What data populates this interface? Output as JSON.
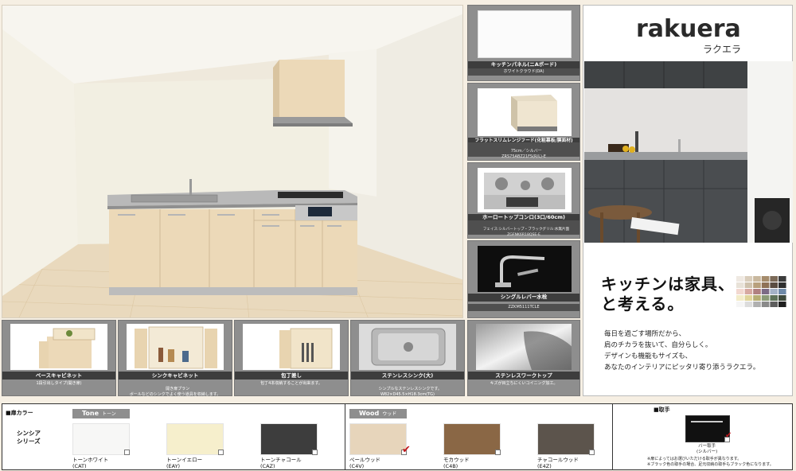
{
  "options": [
    {
      "caption": "キッチンパネル(ニAボード)",
      "note": "ホワイトクラウド(DA)"
    },
    {
      "caption": "フラットスリムレンジフード(化粧幕板/膜面材)",
      "note": "75cm／シルバー\nZRS75ABZ21FS(R/L)-E"
    },
    {
      "caption": "ホーロートップコンロ(3口/60cm)",
      "note": "フェイス:シルバートップ・ブラックグリル:水無片面\nZGFNK6R18QSE-E"
    },
    {
      "caption": "シングルレバー水栓",
      "note": "ZZKM5111TCLE"
    },
    {
      "caption": "ステンレスワークトップ",
      "note": "キズが目立ちにくいコイニング加工。"
    }
  ],
  "features": [
    {
      "title": "ベースキャビネット",
      "desc": "1段引出しタイプ(開き扉)"
    },
    {
      "title": "シンクキャビネット",
      "desc": "開き扉プラン\nボールなどのシンクでよく使う道具を収納します。"
    },
    {
      "title": "包丁差し",
      "desc": "包丁4本収納することが出来ます。"
    },
    {
      "title": "ステンレスシンク(大)",
      "desc": "シンプルなステンレスシンクです。\nW82×D45.5×H18.3cm(TG)"
    }
  ],
  "brand": {
    "logo": "rakuera",
    "logo_kana": "ラクエラ",
    "headline_line1": "キッチンは家具、",
    "headline_line2": "と考える。",
    "body": [
      "毎日を過ごす場所だから、",
      "肩のチカラを抜いて、自分らしく。",
      "デザインも機能もサイズも、",
      "あなたのインテリアにピッタリ寄り添うラクエラ。"
    ]
  },
  "colorbar": {
    "section_label": "■扉カラー",
    "series_label_1": "シンシア",
    "series_label_2": "シリーズ",
    "tone_group": "Tone",
    "tone_group_kana": "トーン",
    "wood_group": "Wood",
    "wood_group_kana": "ウッド",
    "handle_label": "■取手",
    "handle_name": "バー取手",
    "handle_sub": "(シルバー)",
    "note_1": "※扉によってはお選びいただける取手が異なります。",
    "note_2": "※ブラック色の取手の場合、足元収納の取手もブラック色になります。",
    "colors": [
      {
        "name": "トーンホワイト",
        "code": "(CAT)",
        "hex": "#f7f7f6"
      },
      {
        "name": "トーンイエロー",
        "code": "(EAY)",
        "hex": "#f6efcc"
      },
      {
        "name": "トーンチャコール",
        "code": "(CAZ)",
        "hex": "#3d3d3d"
      },
      {
        "name": "ペールウッド",
        "code": "(C4V)",
        "hex": "#e7d5bb"
      },
      {
        "name": "モカウッド",
        "code": "(C4B)",
        "hex": "#8a6745"
      },
      {
        "name": "チャコールウッド",
        "code": "(E4Z)",
        "hex": "#5c544c"
      }
    ],
    "selected_check": "✔"
  }
}
